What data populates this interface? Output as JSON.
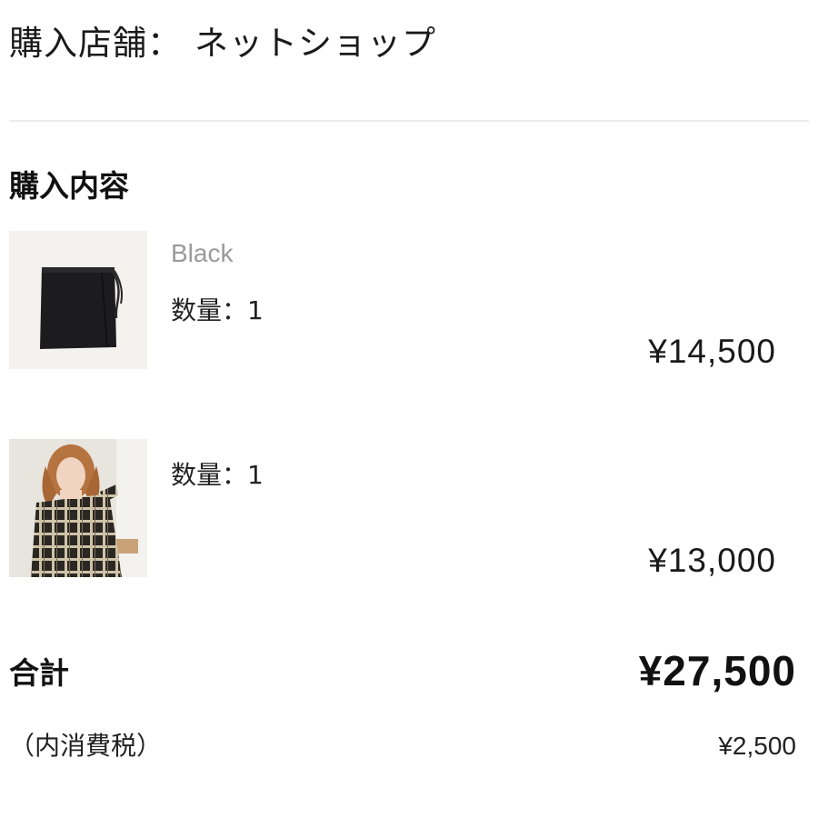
{
  "store": {
    "label": "購入店舗：",
    "value": "ネットショップ"
  },
  "section_title": "購入内容",
  "items": [
    {
      "color": "Black",
      "quantity_text": "数量：1",
      "price": "¥14,500",
      "thumbnail": "black-wrap-skirt-photo"
    },
    {
      "quantity_text": "数量：1",
      "price": "¥13,000",
      "thumbnail": "plaid-dress-model-photo"
    }
  ],
  "total": {
    "label": "合計",
    "value": "¥27,500"
  },
  "tax": {
    "label": "（内消費税）",
    "value": "¥2,500"
  }
}
